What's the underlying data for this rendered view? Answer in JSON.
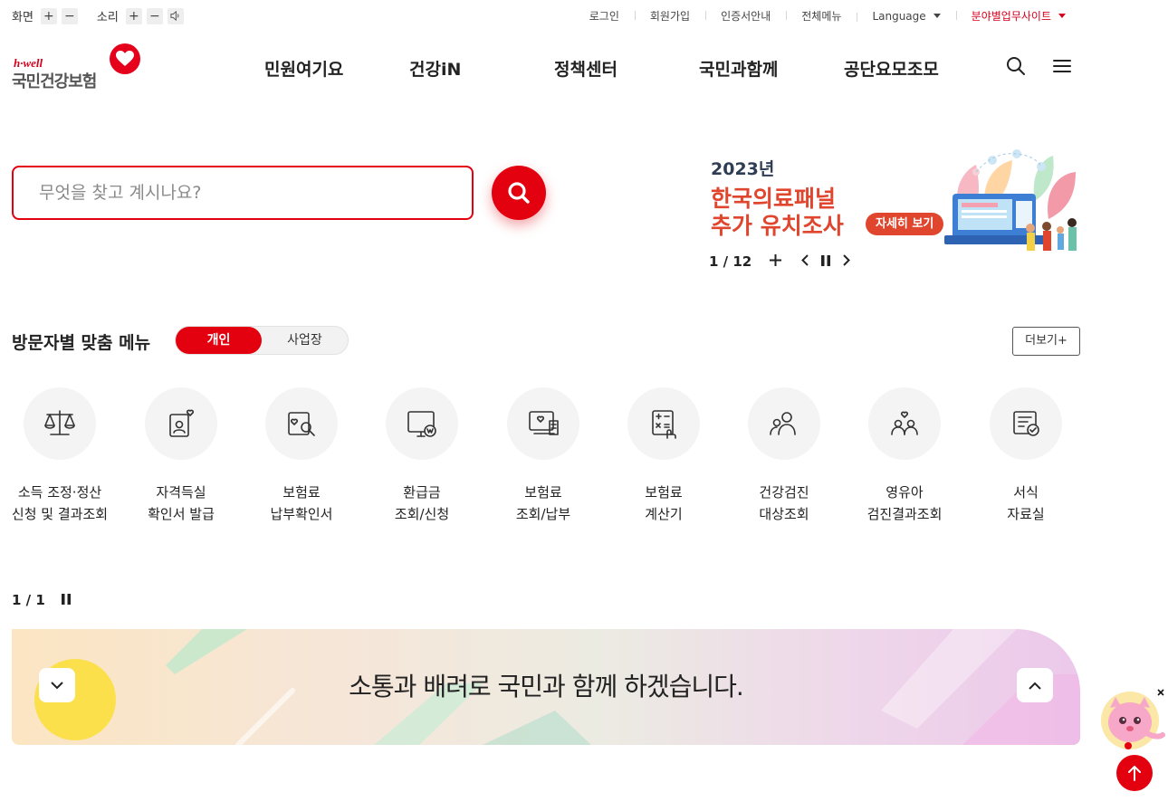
{
  "util": {
    "screen_label": "화면",
    "sound_label": "소리",
    "plus": "+",
    "minus": "−",
    "links": [
      "로그인",
      "회원가입",
      "인증서안내",
      "전체메뉴",
      "Language",
      "분야별업무사이트"
    ]
  },
  "logo": {
    "hwell": "h·well",
    "name": "국민건강보험"
  },
  "gnb": [
    "민원여기요",
    "건강iN",
    "정책센터",
    "국민과함께",
    "공단요모조모"
  ],
  "search": {
    "placeholder": "무엇을 찾고 계시나요?"
  },
  "banner": {
    "year": "2023년",
    "title_line1": "한국의료패널",
    "title_line2": "추가 유치조사",
    "button": "자세히 보기",
    "pager": "1 / 12"
  },
  "visitor_menu": {
    "title": "방문자별 맞춤 메뉴",
    "tabs": [
      "개인",
      "사업장"
    ],
    "more": "더보기+",
    "items": [
      {
        "line1": "소득 조정·정산",
        "line2": "신청 및 결과조회",
        "icon": "scale-icon"
      },
      {
        "line1": "자격득실",
        "line2": "확인서 발급",
        "icon": "id-card-heart-icon"
      },
      {
        "line1": "보험료",
        "line2": "납부확인서",
        "icon": "document-search-icon"
      },
      {
        "line1": "환급금",
        "line2": "조회/신청",
        "icon": "monitor-coin-icon"
      },
      {
        "line1": "보험료",
        "line2": "조회/납부",
        "icon": "monitor-receipt-icon"
      },
      {
        "line1": "보험료",
        "line2": "계산기",
        "icon": "calculator-icon"
      },
      {
        "line1": "건강검진",
        "line2": "대상조회",
        "icon": "people-search-icon"
      },
      {
        "line1": "영유아",
        "line2": "검진결과조회",
        "icon": "family-heart-icon"
      },
      {
        "line1": "서식",
        "line2": "자료실",
        "icon": "form-check-icon"
      }
    ],
    "pager": "1 / 1"
  },
  "slogan": {
    "text": "소통과 배려로 국민과 함께 하겠습니다."
  },
  "colors": {
    "brand_red": "#e3000f",
    "banner_orange": "#e0452e",
    "navy": "#2e3c54"
  }
}
